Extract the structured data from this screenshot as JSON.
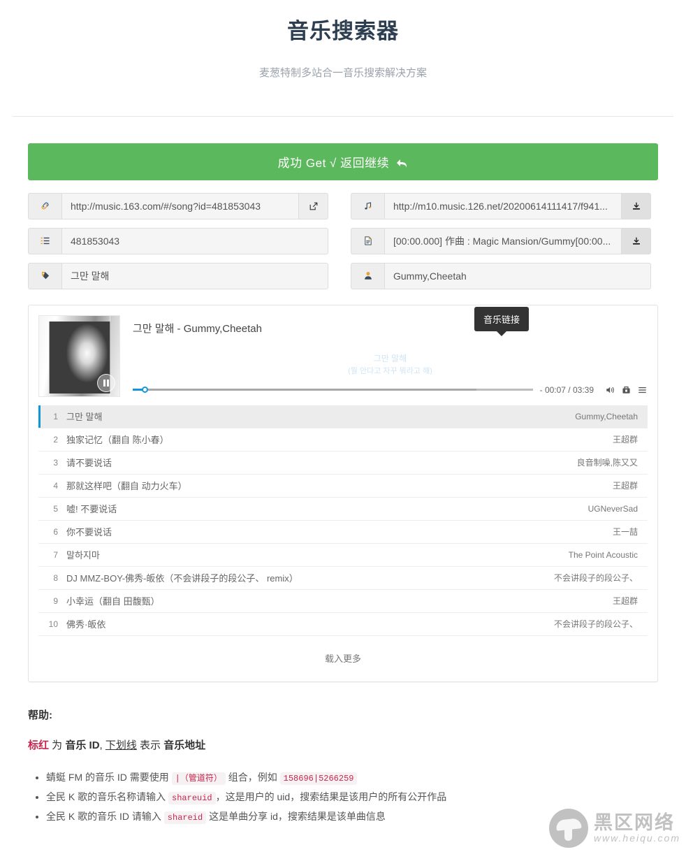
{
  "header": {
    "title": "音乐搜索器",
    "subtitle": "麦葱特制多站合一音乐搜索解决方案"
  },
  "banner": {
    "text": "成功 Get √ 返回继续",
    "arrow": "↰",
    "color": "#5cb85c"
  },
  "tooltip": {
    "label": "音乐链接"
  },
  "fields": {
    "left": [
      {
        "icon": "link-icon",
        "value": "http://music.163.com/#/song?id=481853043",
        "button": "external-link-icon",
        "name": "song-page-url"
      },
      {
        "icon": "ordered-list-icon",
        "value": "481853043",
        "button": null,
        "name": "song-id"
      },
      {
        "icon": "tag-icon",
        "value": "그만 말해",
        "button": null,
        "name": "song-name"
      }
    ],
    "right": [
      {
        "icon": "music-note-icon",
        "value": "http://m10.music.126.net/20200614111417/f941...",
        "button": "download-icon",
        "name": "music-file-url"
      },
      {
        "icon": "document-icon",
        "value": "[00:00.000] 作曲 : Magic Mansion/Gummy[00:00...",
        "button": "download-icon",
        "name": "lyrics-text"
      },
      {
        "icon": "user-icon",
        "value": "Gummy,Cheetah",
        "button": null,
        "name": "artist-name"
      }
    ]
  },
  "player": {
    "song_title": "그만 말해 - Gummy,Cheetah",
    "lyric_line_1": "그만 말해",
    "lyric_line_2": "(뭘 안다고 자꾸 뭐라고 해)",
    "current_time": "- 00:07",
    "separator": "/",
    "total_time": "03:39",
    "time_display": "- 00:07 / 03:39",
    "progress_percent": 3,
    "loaded_percent": 86,
    "accent_color": "#1296db",
    "lyric_color": "#cfe4f5",
    "controls": [
      "volume-icon",
      "download-icon",
      "playlist-icon"
    ]
  },
  "playlist": {
    "rows": [
      {
        "index": "1",
        "title": "그만 말해",
        "artist": "Gummy,Cheetah",
        "active": true
      },
      {
        "index": "2",
        "title": "独家记忆（翻自 陈小春）",
        "artist": "王超群",
        "active": false
      },
      {
        "index": "3",
        "title": "请不要说话",
        "artist": "良音制噪,陈又又",
        "active": false
      },
      {
        "index": "4",
        "title": "那就这样吧（翻自 动力火车）",
        "artist": "王超群",
        "active": false
      },
      {
        "index": "5",
        "title": "嘘! 不要说话",
        "artist": "UGNeverSad",
        "active": false
      },
      {
        "index": "6",
        "title": "你不要说话",
        "artist": "王一喆",
        "active": false
      },
      {
        "index": "7",
        "title": "말하지마",
        "artist": "The Point Acoustic",
        "active": false
      },
      {
        "index": "8",
        "title": "DJ MMZ-BOY-佛秀-皈依（不会讲段子的段公子、 remix）",
        "artist": "不会讲段子的段公子、",
        "active": false
      },
      {
        "index": "9",
        "title": "小幸运（翻自 田馥甄）",
        "artist": "王超群",
        "active": false
      },
      {
        "index": "10",
        "title": "佛秀·皈依",
        "artist": "不会讲段子的段公子、",
        "active": false
      }
    ],
    "load_more": "载入更多"
  },
  "help": {
    "title": "帮助:",
    "legend": {
      "red_word": "标红",
      "after_red": " 为 ",
      "bold_1": "音乐 ID",
      "comma": ", ",
      "underline_word": "下划线",
      "after_underline": " 表示 ",
      "bold_2": "音乐地址"
    },
    "items": [
      {
        "part1": "蜻蜓 FM 的音乐 ID 需要使用 ",
        "code1": "|（管道符）",
        "part2": " 组合，例如 ",
        "code2": "158696|5266259",
        "part3": ""
      },
      {
        "part1": "全民 K 歌的音乐名称请输入 ",
        "code1": "shareuid",
        "part2": "，这是用户的 uid，搜索结果是该用户的所有公开作品",
        "code2": "",
        "part3": ""
      },
      {
        "part1": "全民 K 歌的音乐 ID 请输入 ",
        "code1": "shareid",
        "part2": " 这是单曲分享 id，搜索结果是该单曲信息",
        "code2": "",
        "part3": ""
      }
    ]
  },
  "watermark": {
    "main": "黑区网络",
    "sub": "www.heiqu.com"
  }
}
